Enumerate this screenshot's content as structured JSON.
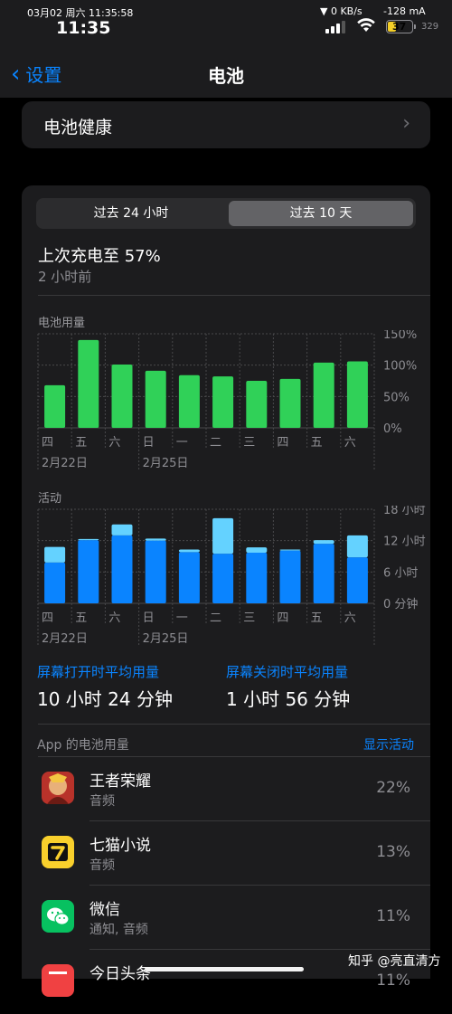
{
  "status_bar": {
    "datetime": "03月02 周六 11:35:58",
    "time": "11:35",
    "network_speed": "▼ 0 KB/s",
    "current": "-128 mA",
    "battery_level": "37",
    "battery_fraction": 0.37,
    "capacity": "329",
    "icons": [
      "signal-icon",
      "wifi-icon",
      "battery-icon"
    ]
  },
  "nav": {
    "back_label": "设置",
    "title": "电池"
  },
  "health": {
    "label": "电池健康"
  },
  "segments": {
    "option1": "过去 24 小时",
    "option2": "过去 10 天",
    "selected": "过去 10 天"
  },
  "last_charge": {
    "title": "上次充电至 57%",
    "time": "2 小时前"
  },
  "battery_chart": {
    "label": "电池用量",
    "color": "#30d158"
  },
  "activity_chart": {
    "label": "活动",
    "color_on": "#0a84ff",
    "color_off": "#64d2ff"
  },
  "averages": {
    "screen_on_label": "屏幕打开时平均用量",
    "screen_on_value": "10 小时 24 分钟",
    "screen_off_label": "屏幕关闭时平均用量",
    "screen_off_value": "1 小时 56 分钟"
  },
  "apps_section": {
    "title": "App 的电池用量",
    "toggle": "显示活动"
  },
  "apps": [
    {
      "name": "王者荣耀",
      "detail": "音频",
      "percent": "22%",
      "icon": "honor-of-kings-icon"
    },
    {
      "name": "七猫小说",
      "detail": "音频",
      "percent": "13%",
      "icon": "qimao-icon"
    },
    {
      "name": "微信",
      "detail": "通知, 音频",
      "percent": "11%",
      "icon": "wechat-icon"
    },
    {
      "name": "今日头条",
      "detail": "",
      "percent": "11%",
      "icon": "toutiao-icon"
    }
  ],
  "watermark": "知乎 @亮直清方",
  "chart_data": [
    {
      "type": "bar",
      "title": "电池用量",
      "categories": [
        "四",
        "五",
        "六",
        "日",
        "一",
        "二",
        "三",
        "四",
        "五",
        "六"
      ],
      "date_labels": [
        "2月22日",
        "2月25日"
      ],
      "y_ticks": [
        "0%",
        "50%",
        "100%",
        "150%"
      ],
      "ylim": [
        0,
        150
      ],
      "values": [
        68,
        140,
        101,
        91,
        84,
        82,
        75,
        78,
        104,
        106
      ]
    },
    {
      "type": "bar",
      "title": "活动",
      "categories": [
        "四",
        "五",
        "六",
        "日",
        "一",
        "二",
        "三",
        "四",
        "五",
        "六"
      ],
      "date_labels": [
        "2月22日",
        "2月25日"
      ],
      "y_ticks": [
        "0 分钟",
        "6 小时",
        "12 小时",
        "18 小时"
      ],
      "ylim": [
        0,
        18
      ],
      "series": [
        {
          "name": "屏幕打开",
          "values": [
            7.8,
            12.1,
            13.0,
            12.0,
            9.8,
            9.5,
            9.7,
            10.1,
            11.4,
            8.8
          ]
        },
        {
          "name": "屏幕关闭",
          "values": [
            3.0,
            0.2,
            2.1,
            0.4,
            0.5,
            6.8,
            1.0,
            0.2,
            0.7,
            4.2
          ]
        }
      ]
    }
  ]
}
